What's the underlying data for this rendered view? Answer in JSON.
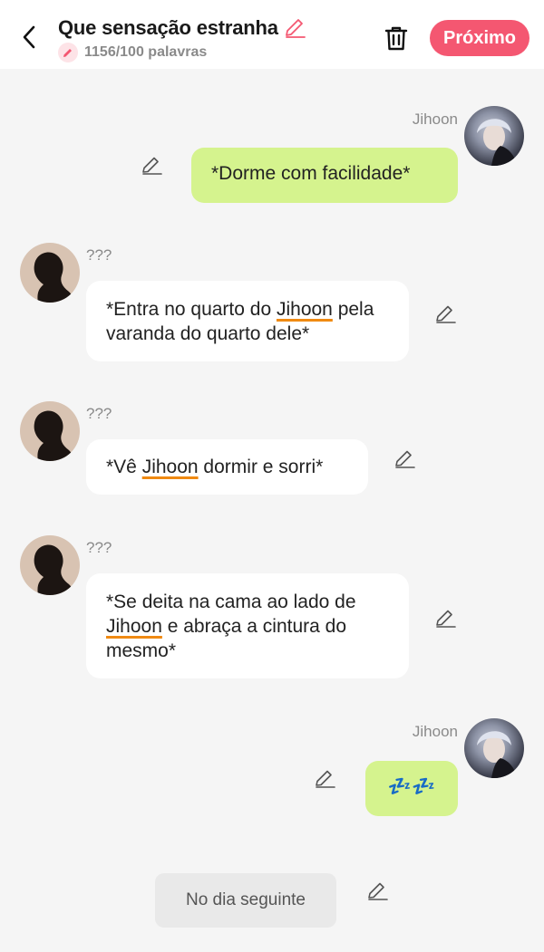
{
  "header": {
    "title": "Que sensação estranha",
    "word_count": "1156/100 palavras",
    "next_label": "Próximo",
    "accent_color": "#f45771"
  },
  "messages": [
    {
      "speaker": "Jihoon",
      "side": "right",
      "text": "*Dorme com facilidade*"
    },
    {
      "speaker": "???",
      "side": "left",
      "parts": [
        "*Entra no quarto do ",
        "Jihoon",
        " pela varanda do quarto dele*"
      ]
    },
    {
      "speaker": "???",
      "side": "left",
      "parts": [
        "*Vê ",
        "Jihoon",
        " dormir e sorri*"
      ]
    },
    {
      "speaker": "???",
      "side": "left",
      "parts": [
        "*Se deita na cama ao lado de ",
        "Jihoon",
        " e abraça a cintura do mesmo*"
      ]
    },
    {
      "speaker": "Jihoon",
      "side": "right",
      "text": "💤💤"
    }
  ],
  "narration": {
    "text": "No dia seguinte"
  },
  "icons": {
    "back": "chevron-left-icon",
    "title_edit": "pencil-icon",
    "word_badge": "pencil-icon",
    "delete": "trash-icon",
    "message_edit": "pencil-icon"
  }
}
